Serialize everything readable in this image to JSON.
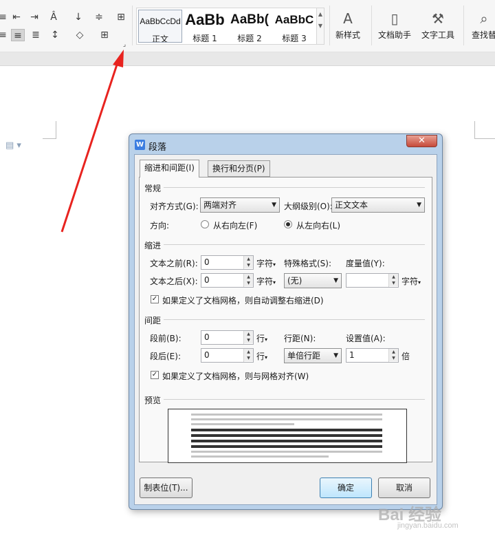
{
  "ribbon": {
    "styles": [
      {
        "sample": "AaBbCcDd",
        "name": "正文"
      },
      {
        "sample": "AaBb",
        "name": "标题 1"
      },
      {
        "sample": "AaBb(",
        "name": "标题 2"
      },
      {
        "sample": "AaBbC",
        "name": "标题 3"
      }
    ],
    "new_style_label": "新样式",
    "doc_assistant_label": "文档助手",
    "text_tools_label": "文字工具",
    "find_label": "查找替"
  },
  "dialog": {
    "title": "段落",
    "close_symbol": "✕",
    "tabs": [
      "缩进和间距(I)",
      "换行和分页(P)"
    ],
    "general": {
      "section": "常规",
      "align_label": "对齐方式(G):",
      "align_value": "两端对齐",
      "outline_label": "大纲级别(O):",
      "outline_value": "正文文本",
      "direction_label": "方向:",
      "rtl_label": "从右向左(F)",
      "ltr_label": "从左向右(L)",
      "direction_selected": "ltr"
    },
    "indent": {
      "section": "缩进",
      "before_label": "文本之前(R):",
      "before_value": "0",
      "before_unit": "字符",
      "after_label": "文本之后(X):",
      "after_value": "0",
      "after_unit": "字符",
      "special_label": "特殊格式(S):",
      "special_value": "(无)",
      "measure_label": "度量值(Y):",
      "measure_value": "",
      "measure_unit": "字符",
      "auto_adjust_label": "如果定义了文档网格，则自动调整右缩进(D)",
      "auto_adjust_checked": true
    },
    "spacing": {
      "section": "间距",
      "before_label": "段前(B):",
      "before_value": "0",
      "before_unit": "行",
      "after_label": "段后(E):",
      "after_value": "0",
      "after_unit": "行",
      "line_spacing_label": "行距(N):",
      "line_spacing_value": "单倍行距",
      "set_value_label": "设置值(A):",
      "set_value": "1",
      "set_value_unit": "倍",
      "snap_grid_label": "如果定义了文档网格，则与网格对齐(W)",
      "snap_grid_checked": true
    },
    "preview": {
      "section": "预览"
    },
    "buttons": {
      "tabs": "制表位(T)...",
      "ok": "确定",
      "cancel": "取消"
    }
  },
  "watermark": {
    "main": "Bai 经验",
    "sub": "jingyan.baidu.com"
  },
  "colors": {
    "arrow": "#e8231f",
    "dialog_frame": "#b9d1ea",
    "ok_button": "#bee6fd"
  }
}
